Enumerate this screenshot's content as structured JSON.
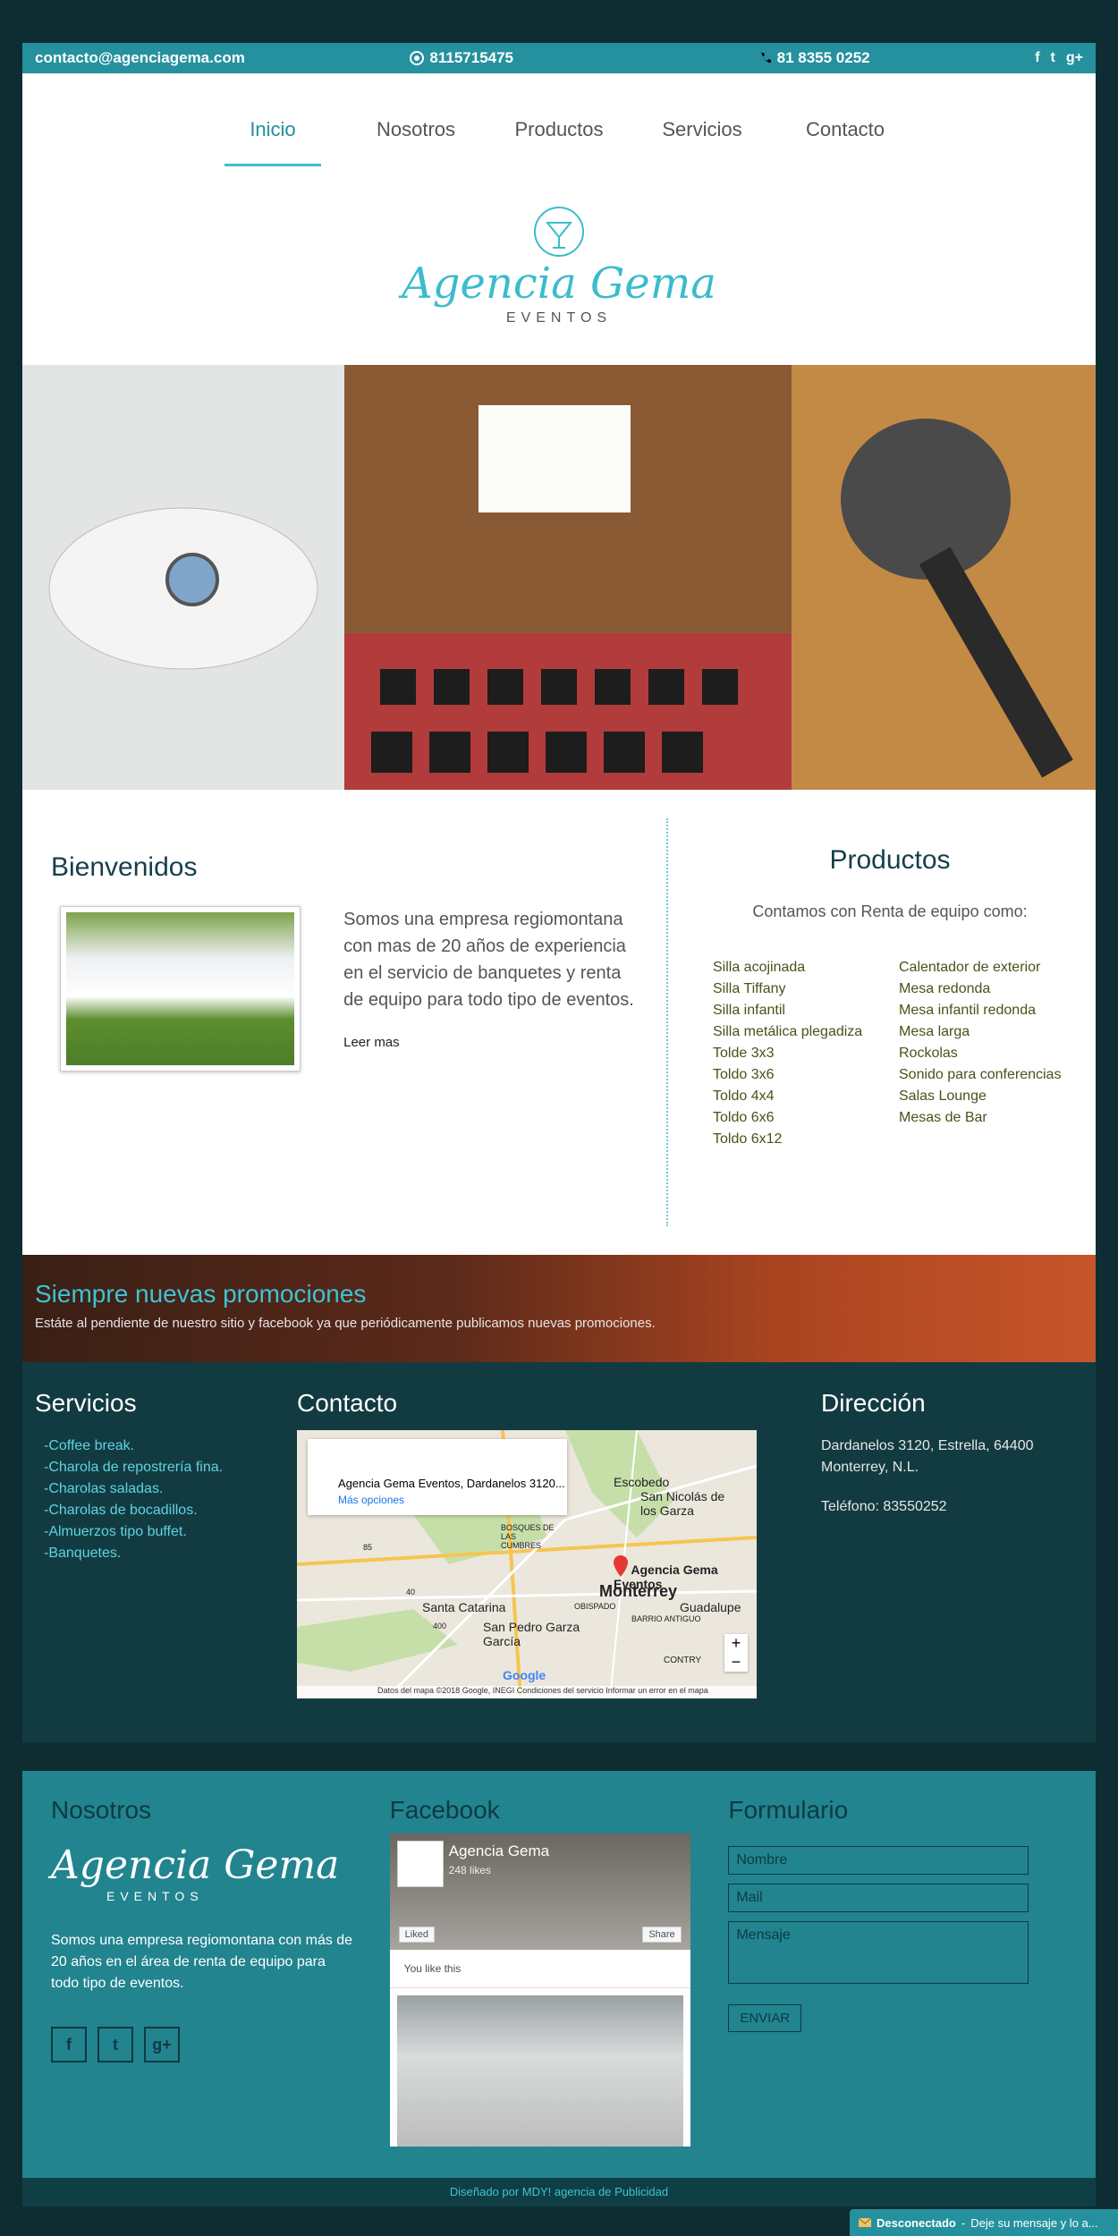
{
  "topbar": {
    "email": "contacto@agenciagema.com",
    "whatsapp": "8115715475",
    "phone": "81 8355 0252",
    "social_icons": [
      "facebook-icon",
      "twitter-icon",
      "google-plus-icon"
    ]
  },
  "nav": {
    "items": [
      {
        "label": "Inicio",
        "active": true
      },
      {
        "label": "Nosotros",
        "active": false
      },
      {
        "label": "Productos",
        "active": false
      },
      {
        "label": "Servicios",
        "active": false
      },
      {
        "label": "Contacto",
        "active": false
      }
    ]
  },
  "logo": {
    "name": "Agencia Gema",
    "subtitle": "EVENTOS"
  },
  "welcome": {
    "title": "Bienvenidos",
    "text": "Somos una empresa regiomontana con mas de 20 años de experiencia en el servicio de banquetes y renta de equipo para todo tipo de eventos.",
    "more": "Leer mas"
  },
  "products": {
    "title": "Productos",
    "subtitle": "Contamos con Renta de equipo como:",
    "col1": [
      "Silla acojinada",
      "Silla Tiffany",
      "Silla infantil",
      "Silla metálica plegadiza",
      "Tolde 3x3",
      "Toldo 3x6",
      "Toldo 4x4",
      "Toldo 6x6",
      "Toldo 6x12"
    ],
    "col2": [
      "Calentador de exterior",
      "Mesa redonda",
      "Mesa infantil redonda",
      "Mesa larga",
      "Rockolas",
      "Sonido para conferencias",
      "Salas Lounge",
      "Mesas de Bar"
    ]
  },
  "promo": {
    "title": "Siempre nuevas promociones",
    "text": "Estáte al pendiente de nuestro sitio y facebook ya que periódicamente publicamos nuevas promociones."
  },
  "services": {
    "title": "Servicios",
    "items": [
      "-Coffee break.",
      "-Charola de repostrería fina.",
      "-Charolas saladas.",
      "-Charolas de bocadillos.",
      "-Almuerzos tipo buffet.",
      "-Banquetes."
    ]
  },
  "contact": {
    "title": "Contacto",
    "map": {
      "address": "Agencia Gema Eventos, Dardanelos 3120...",
      "more_options": "Más opciones",
      "marker_label": "Agencia Gema Eventos",
      "labels": [
        "Escobedo",
        "San Nicolás de los Garza",
        "BOSQUES DE LAS CUMBRES",
        "Santa Catarina",
        "Monterrey",
        "Guadalupe",
        "BARRIO ANTIGUO",
        "OBISPADO",
        "San Pedro Garza García",
        "CONTRY"
      ],
      "road_numbers": [
        "85",
        "40",
        "400"
      ],
      "google": "Google",
      "footer": "Datos del mapa ©2018 Google, INEGI   Condiciones del servicio   Informar un error en el mapa",
      "zoom_in": "+",
      "zoom_out": "−"
    }
  },
  "direction": {
    "title": "Dirección",
    "address": "Dardanelos 3120, Estrella, 64400 Monterrey, N.L.",
    "phone": "Teléfono: 83550252"
  },
  "about": {
    "title": "Nosotros",
    "logo_name": "Agencia Gema",
    "logo_subtitle": "EVENTOS",
    "text": "Somos una empresa regiomontana con más de 20 años en el área de renta de equipo para todo tipo de eventos.",
    "social": [
      "f",
      "t",
      "g+"
    ]
  },
  "facebook": {
    "title": "Facebook",
    "page_name": "Agencia Gema",
    "likes": "248 likes",
    "liked": "Liked",
    "share": "Share",
    "you_like": "You like this"
  },
  "form": {
    "title": "Formulario",
    "name_placeholder": "Nombre",
    "mail_placeholder": "Mail",
    "message_placeholder": "Mensaje",
    "send": "ENVIAR"
  },
  "credits": "Diseñado por MDY! agencia de Publicidad",
  "chat": {
    "status": "Desconectado",
    "separator": "-",
    "text": "Deje su mensaje y lo a..."
  }
}
